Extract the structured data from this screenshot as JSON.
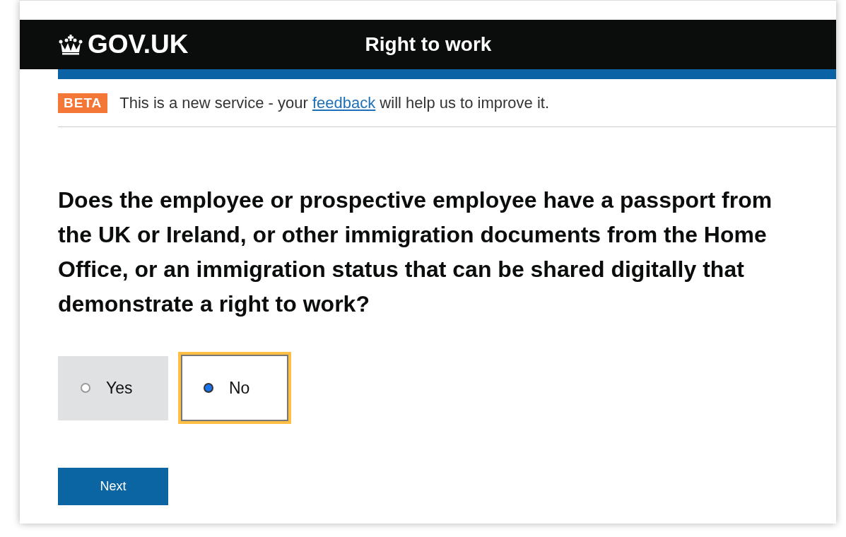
{
  "header": {
    "logo": "GOV.UK",
    "service": "Right to work"
  },
  "phase_banner": {
    "tag": "BETA",
    "before": "This is a new service - your",
    "link": "feedback",
    "after": "will help us to improve it."
  },
  "question": "Does the employee or prospective employee have a passport from the UK or Ireland, or other immigration documents from the Home Office, or an immigration status that can be shared digitally that demonstrate a right to work?",
  "options": [
    {
      "label": "Yes",
      "selected": false
    },
    {
      "label": "No",
      "selected": true
    }
  ],
  "button": "Next"
}
